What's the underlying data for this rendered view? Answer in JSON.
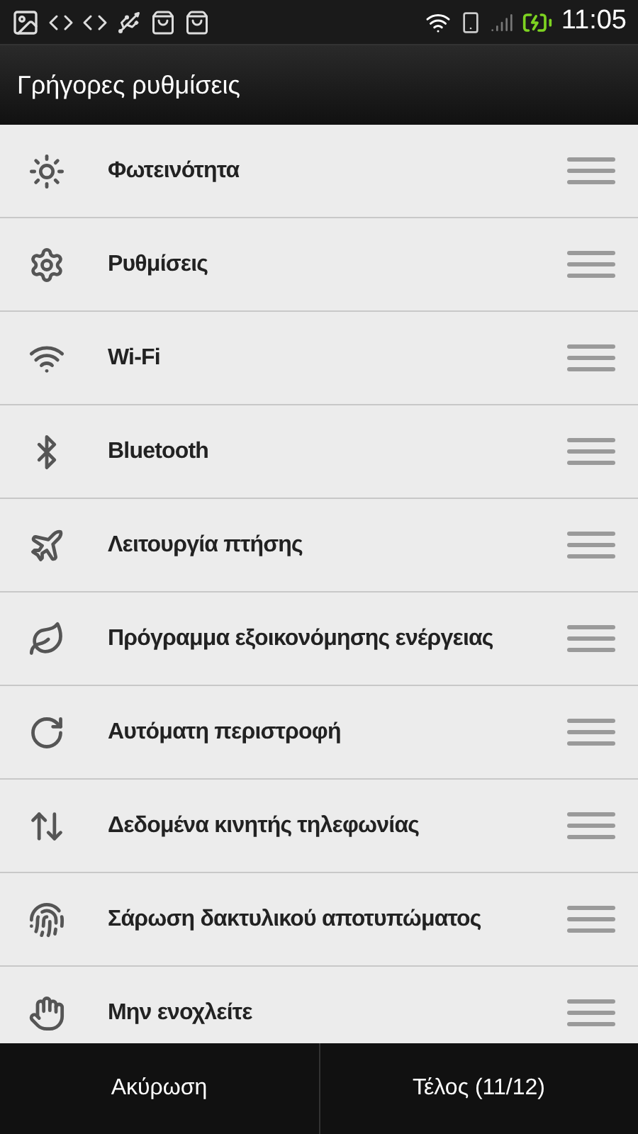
{
  "status_bar": {
    "time": "11:05"
  },
  "title": "Γρήγορες ρυθμίσεις",
  "items": [
    {
      "label": "Φωτεινότητα"
    },
    {
      "label": "Ρυθμίσεις"
    },
    {
      "label": "Wi-Fi"
    },
    {
      "label": "Bluetooth"
    },
    {
      "label": "Λειτουργία πτήσης"
    },
    {
      "label": "Πρόγραμμα εξοικονόμησης ενέργειας"
    },
    {
      "label": "Αυτόματη περιστροφή"
    },
    {
      "label": "Δεδομένα κινητής τηλεφωνίας"
    },
    {
      "label": "Σάρωση δακτυλικού αποτυπώματος"
    },
    {
      "label": "Μην ενοχλείτε"
    }
  ],
  "buttons": [
    "Ακύρωση",
    "Τέλος (11/12)"
  ]
}
